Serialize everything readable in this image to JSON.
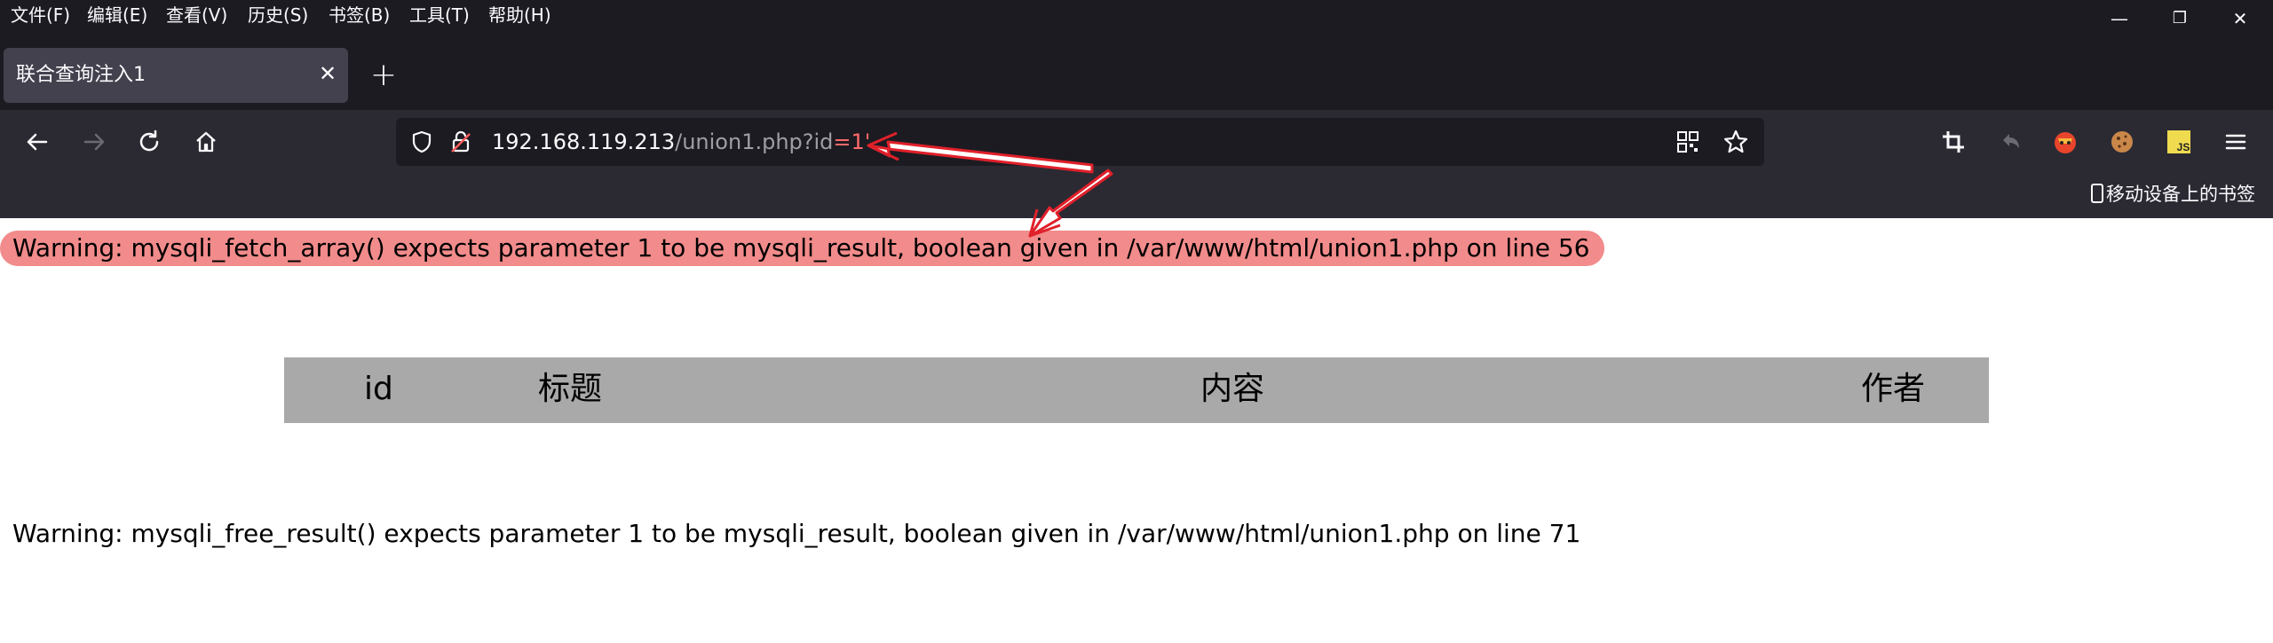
{
  "menubar": {
    "items": [
      "文件(F)",
      "编辑(E)",
      "查看(V)",
      "历史(S)",
      "书签(B)",
      "工具(T)",
      "帮助(H)"
    ]
  },
  "window_controls": {
    "minimize": "—",
    "restore": "❐",
    "close": "✕"
  },
  "tab": {
    "title": "联合查询注入1",
    "close": "✕"
  },
  "new_tab": "+",
  "urlbar": {
    "host": "192.168.119.213",
    "path": "/union1.php?id",
    "param": "=1'"
  },
  "toolbar_icons": [
    "crop-icon",
    "undo-icon",
    "extension-icon",
    "cookie-icon",
    "js-icon",
    "menu-icon"
  ],
  "bookmarks": {
    "mobile": "移动设备上的书签"
  },
  "page": {
    "warning1": "Warning: mysqli_fetch_array() expects parameter 1 to be mysqli_result, boolean given in /var/www/html/union1.php on line 56",
    "table_headers": [
      "id",
      "标题",
      "内容",
      "作者"
    ],
    "warning2": "Warning: mysqli_free_result() expects parameter 1 to be mysqli_result, boolean given in /var/www/html/union1.php on line 71"
  },
  "colors": {
    "chrome_bg": "#1c1b22",
    "nav_bg": "#2b2a33",
    "warning_highlight": "#f28b8b",
    "table_header_bg": "#a9a9a9",
    "annotation_arrow": "#e0202a"
  }
}
